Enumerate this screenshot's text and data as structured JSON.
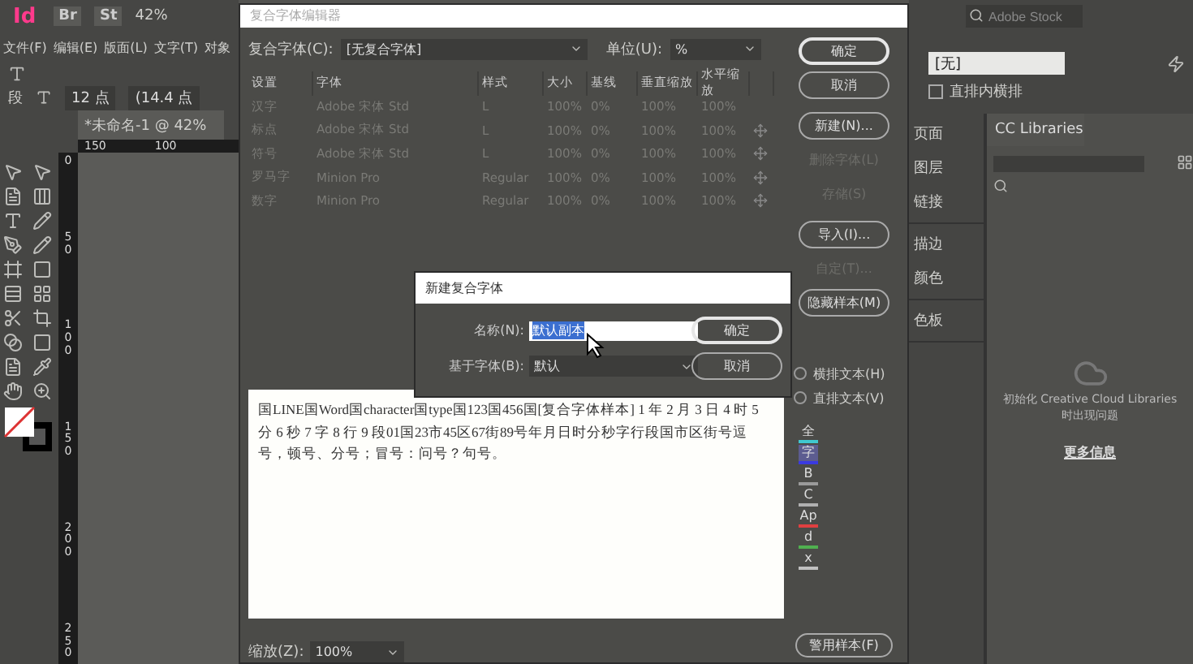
{
  "app": {
    "logo": "Id",
    "bridge": "Br",
    "stock": "St",
    "zoom": "42%",
    "menus": [
      "文件(F)",
      "编辑(E)",
      "版面(L)",
      "文字(T)",
      "对象"
    ],
    "control": {
      "paragraph": "段",
      "font_size": "12 点",
      "leading": "(14.4 点"
    },
    "document_tab": "*未命名-1 @ 42%",
    "ruler_h": [
      "150",
      "100"
    ],
    "ruler_v": [
      "0",
      "50",
      "100",
      "150",
      "200",
      "250"
    ]
  },
  "right": {
    "stock_search": {
      "placeholder": "Adobe Stock"
    },
    "style_field": "[无]",
    "checkbox": {
      "label": "直排内横排",
      "checked": false
    },
    "panels": [
      [
        "页面",
        "图层",
        "链接"
      ],
      [
        "描边",
        "颜色"
      ],
      [
        "色板"
      ]
    ],
    "libraries": {
      "tab": "CC Libraries",
      "message": "初始化 Creative Cloud Libraries 时出现问题",
      "link": "更多信息"
    }
  },
  "dialog": {
    "title": "复合字体编辑器",
    "composite_label": "复合字体(C):",
    "composite_value": "[无复合字体]",
    "unit_label": "单位(U):",
    "unit_value": "%",
    "columns": [
      "设置",
      "字体",
      "样式",
      "大小",
      "基线",
      "垂直缩放",
      "水平缩放"
    ],
    "rows": [
      {
        "cells": [
          "汉字",
          "Adobe 宋体 Std",
          "L",
          "100%",
          "0%",
          "100%",
          "100%"
        ],
        "movable": false
      },
      {
        "cells": [
          "标点",
          "Adobe 宋体 Std",
          "L",
          "100%",
          "0%",
          "100%",
          "100%"
        ],
        "movable": true
      },
      {
        "cells": [
          "符号",
          "Adobe 宋体 Std",
          "L",
          "100%",
          "0%",
          "100%",
          "100%"
        ],
        "movable": true
      },
      {
        "cells": [
          "罗马字",
          "Minion Pro",
          "Regular",
          "100%",
          "0%",
          "100%",
          "100%"
        ],
        "movable": true
      },
      {
        "cells": [
          "数字",
          "Minion Pro",
          "Regular",
          "100%",
          "0%",
          "100%",
          "100%"
        ],
        "movable": true
      }
    ],
    "buttons": [
      {
        "label": "确定",
        "disabled": false,
        "default": true
      },
      {
        "label": "取消",
        "disabled": false,
        "default": false
      },
      {
        "label": "新建(N)...",
        "disabled": false,
        "default": false
      },
      {
        "label": "删除字体(L)",
        "disabled": true,
        "default": false
      },
      {
        "label": "存储(S)",
        "disabled": true,
        "default": false
      },
      {
        "label": "导入(I)...",
        "disabled": false,
        "default": false
      },
      {
        "label": "自定(T)...",
        "disabled": true,
        "default": false
      },
      {
        "label": "隐藏样本(M)",
        "disabled": false,
        "default": false
      }
    ],
    "orientation": [
      {
        "label": "横排文本(H)",
        "selected": false
      },
      {
        "label": "直排文本(V)",
        "selected": false
      }
    ],
    "sample_marks": [
      {
        "label": "全",
        "color": "#40c8d0",
        "selected": false
      },
      {
        "label": "字",
        "color": "#3a3ae0",
        "selected": true
      },
      {
        "label": "B",
        "color": "#9a9a9a",
        "selected": false
      },
      {
        "label": "C",
        "color": "#b0b0b0",
        "selected": false
      },
      {
        "label": "Ap",
        "color": "#e04040",
        "selected": false
      },
      {
        "label": "d",
        "color": "#50b050",
        "selected": false
      },
      {
        "label": "x",
        "color": "#c0c0c0",
        "selected": false
      }
    ],
    "sample_text": "国LINE国Word国character国type国123国456国[复合字体样本] 1 年 2 月 3 日 4 时 5 分 6 秒 7 字 8 行 9 段01国23市45区67街89号年月日时分秒字行段国市区街号逗号，顿号、分号；冒号：问号？句号。",
    "zoom_label": "缩放(Z):",
    "zoom_value": "100%",
    "sample_button": "警用样本(F)"
  },
  "subdialog": {
    "title": "新建复合字体",
    "name_label": "名称(N):",
    "name_value": "默认副本",
    "base_label": "基于字体(B):",
    "base_value": "默认",
    "buttons": [
      "确定",
      "取消"
    ]
  }
}
